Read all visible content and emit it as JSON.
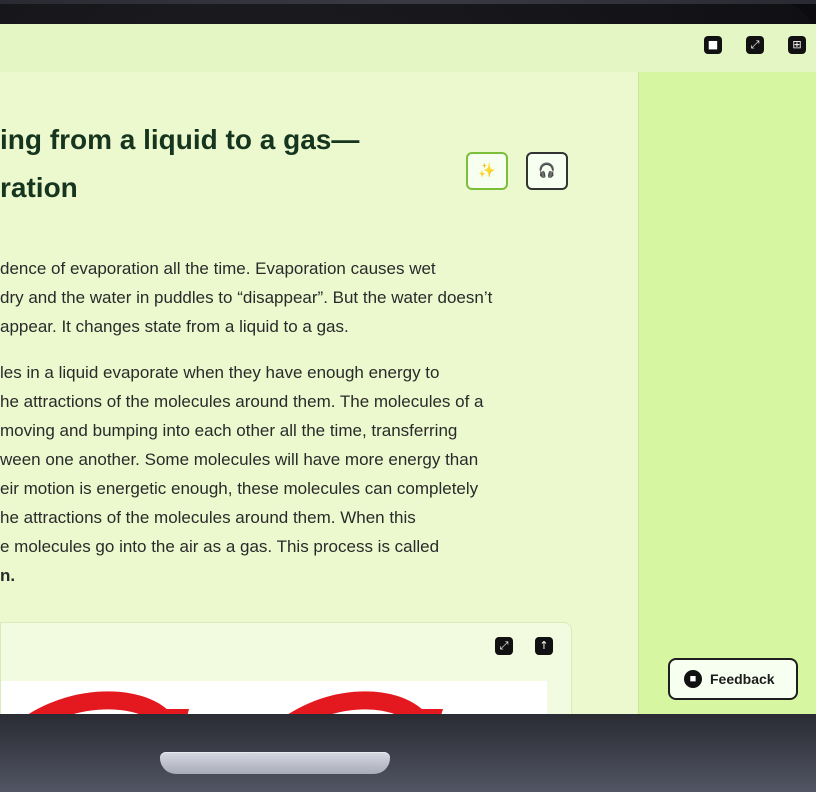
{
  "toolbar": {
    "icons": [
      "comment-icon",
      "expand-icon",
      "apps-icon"
    ]
  },
  "lesson": {
    "title_line1": "ing from a liquid to a gas—",
    "title_line2": "ration",
    "buttons": [
      {
        "name": "magic-wand",
        "glyph": "✨"
      },
      {
        "name": "headphones",
        "glyph": "🎧"
      }
    ],
    "paragraphs": [
      [
        "dence of evaporation all the time. Evaporation causes wet",
        "dry and the water in puddles to “disappear”. But the water doesn’t",
        "appear. It changes state from a liquid to a gas."
      ],
      [
        "les in a liquid evaporate when they have enough energy to",
        "he attractions of the molecules around them. The molecules of a",
        "moving and bumping into each other all the time, transferring",
        "ween one another. Some molecules will have more energy than",
        "eir motion is energetic enough, these molecules can completely",
        "he attractions of the molecules around them. When this",
        "e molecules go into the air as a gas. This process is called",
        "n."
      ]
    ]
  },
  "card": {
    "icons": [
      "fullscreen-icon",
      "upload-icon"
    ]
  },
  "feedback": {
    "label": "Feedback"
  },
  "colors": {
    "screen_bg": "#e9f8c7",
    "side_bg": "#d7f6a2",
    "accent_green": "#7bbf3a",
    "red_arrow": "#e3191f"
  }
}
